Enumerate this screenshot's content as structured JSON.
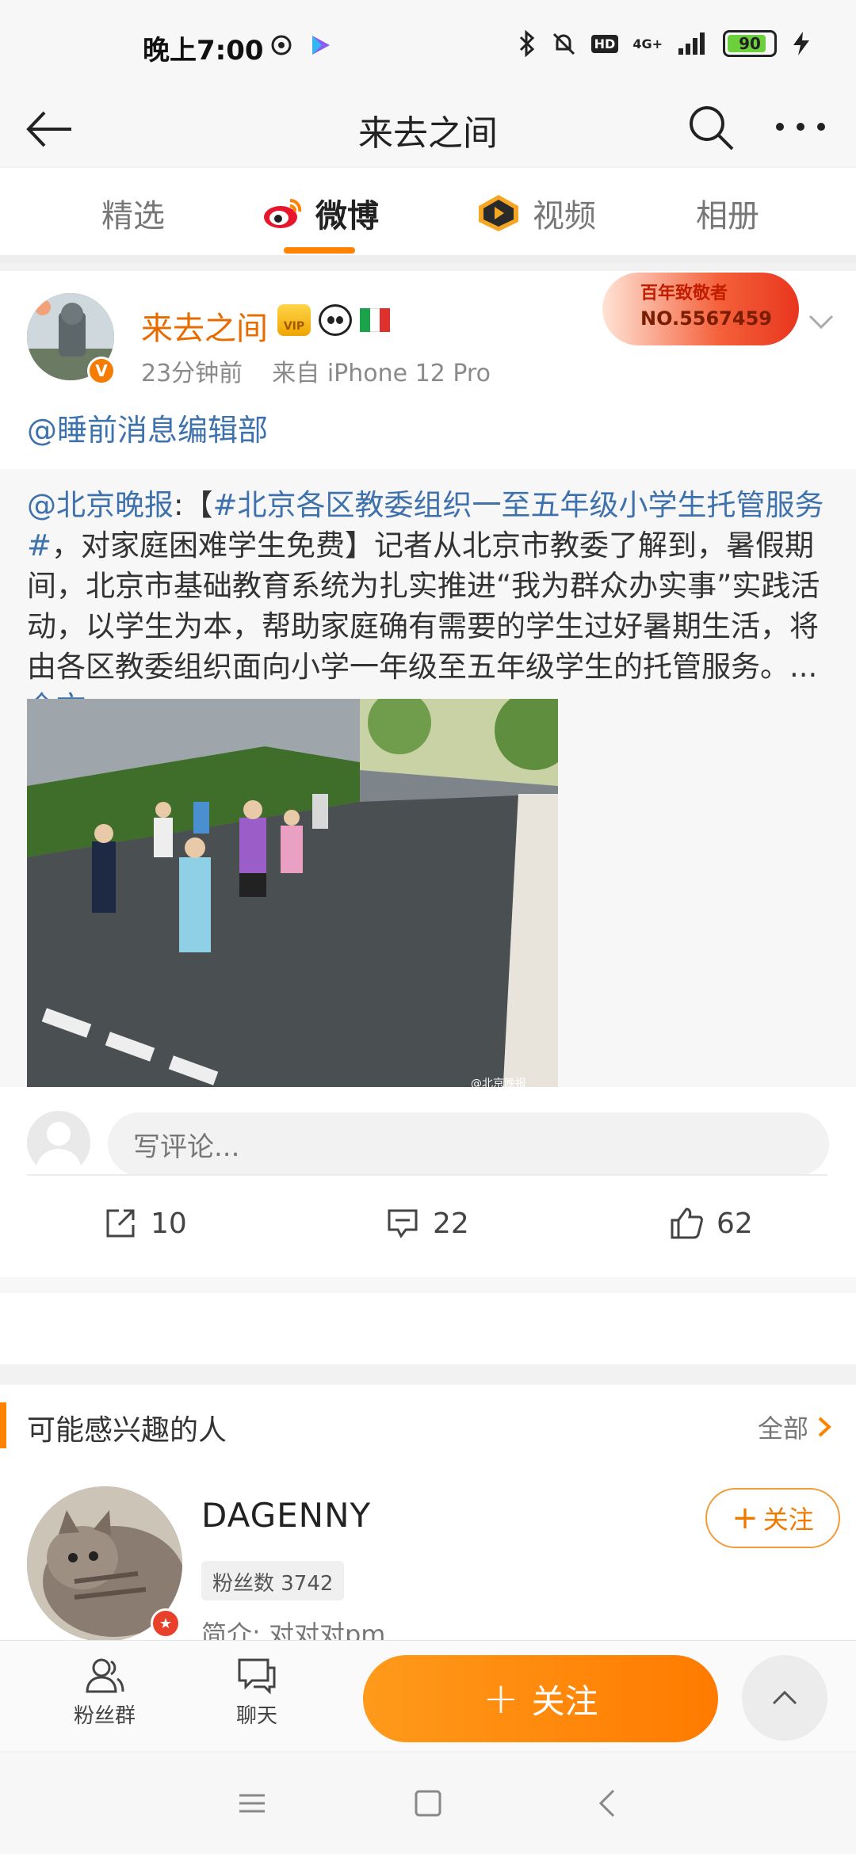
{
  "status_bar": {
    "time": "晚上7:00",
    "network": "4G+",
    "battery": "90",
    "hd": "HD"
  },
  "header": {
    "title": "来去之间"
  },
  "tabs": [
    {
      "label": "精选"
    },
    {
      "label": "微博"
    },
    {
      "label": "视频"
    },
    {
      "label": "相册"
    }
  ],
  "post": {
    "author": "来去之间",
    "time": "23分钟前",
    "source": "来自 iPhone 12 Pro",
    "honor_badge_title": "百年致敬者",
    "honor_badge_number": "NO.5567459",
    "vip_label": "VIP",
    "verified_mark": "V",
    "mention": "@睡前消息编辑部",
    "repost": {
      "author_link": "@北京晚报",
      "colon": ":",
      "bracket_open": "【",
      "topic_link": "#北京各区教委组织一至五年级小学生托管服务#",
      "body": "，对家庭困难学生免费】记者从北京市教委了解到，暑假期间，北京市基础教育系统为扎实推进“我为群众办实事”实践活动，以学生为本，帮助家庭确有需要的学生过好暑期生活，将由各区教委组织面向小学一年级至五年级学生的托管服务。... ",
      "full_text_link": "全文",
      "image_watermark": "@北京晚报"
    },
    "comment_placeholder": "写评论...",
    "reposts": "10",
    "comments": "22",
    "likes": "62"
  },
  "suggestions": {
    "title": "可能感兴趣的人",
    "all_label": "全部",
    "person": {
      "name": "DAGENNY",
      "fans": "粉丝数 3742",
      "intro": "简介: 对对对pm",
      "follow_label": "关注"
    }
  },
  "bottom_bar": {
    "fans_group": "粉丝群",
    "chat": "聊天",
    "follow": "关注"
  },
  "colors": {
    "accent": "#ff8200",
    "link": "#3f72ad",
    "author": "#e86b00"
  }
}
